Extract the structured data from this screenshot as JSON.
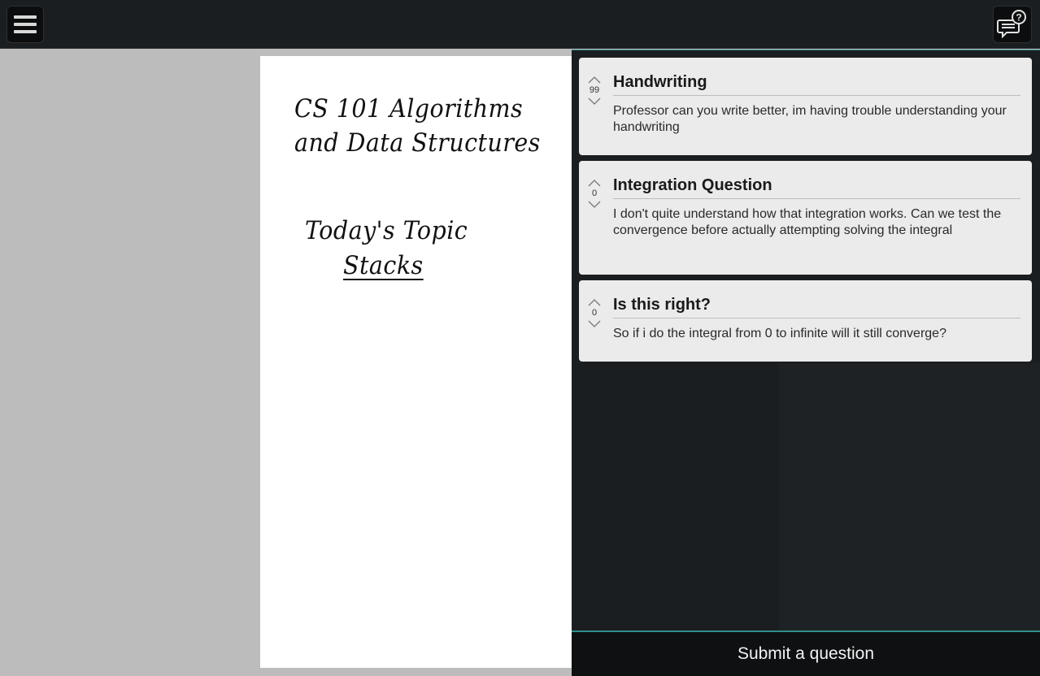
{
  "toolbar": {
    "menu_icon": "hamburger-menu-icon",
    "questions_icon": "question-chat-icon"
  },
  "slide": {
    "title_line1": "CS 101 Algorithms",
    "title_line2": "and Data Structures",
    "topic_label": "Today's Topic",
    "topic_value": "Stacks"
  },
  "questions": [
    {
      "title": "Handwriting",
      "votes": "99",
      "body": "Professor can you write better, im having trouble understanding your handwriting"
    },
    {
      "title": "Integration Question",
      "votes": "0",
      "body": "I don't quite understand how that integration works. Can we test the convergence before actually attempting solving the integral"
    },
    {
      "title": "Is this right?",
      "votes": "0",
      "body": "So if i do the integral from 0 to infinite will it still converge?"
    }
  ],
  "submit": {
    "label": "Submit a question"
  },
  "colors": {
    "topbar": "#1b1e20",
    "panel": "#1b1e20",
    "card": "#ebebeb",
    "accent": "#2f8f8a",
    "canvas": "#bcbcbc"
  }
}
